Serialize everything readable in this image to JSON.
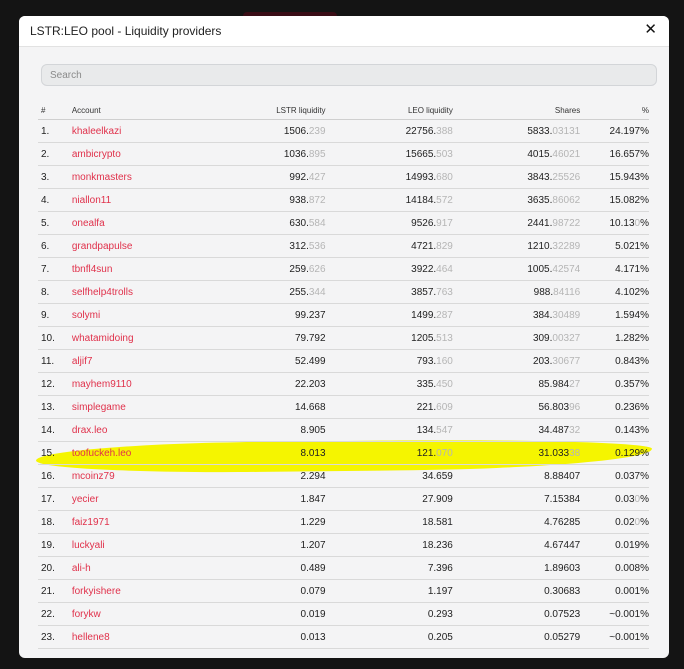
{
  "modal": {
    "title": "LSTR:LEO pool - Liquidity providers",
    "close_label": "✕"
  },
  "search": {
    "placeholder": "Search"
  },
  "table": {
    "headers": {
      "num": "#",
      "account": "Account",
      "lstr": "LSTR liquidity",
      "leo": "LEO liquidity",
      "shares": "Shares",
      "pct": "%"
    },
    "rows": [
      {
        "num": "1.",
        "account": "khaleelkazi",
        "lstr": "1506.",
        "lstr_dim": "239",
        "leo": "22756.",
        "leo_dim": "388",
        "shares": "5833.",
        "shares_dim": "03131",
        "pct": "24.197%",
        "pct_dim": ""
      },
      {
        "num": "2.",
        "account": "ambicrypto",
        "lstr": "1036.",
        "lstr_dim": "895",
        "leo": "15665.",
        "leo_dim": "503",
        "shares": "4015.",
        "shares_dim": "46021",
        "pct": "16.657%",
        "pct_dim": ""
      },
      {
        "num": "3.",
        "account": "monkmasters",
        "lstr": "992.",
        "lstr_dim": "427",
        "leo": "14993.",
        "leo_dim": "680",
        "shares": "3843.",
        "shares_dim": "25526",
        "pct": "15.943%",
        "pct_dim": ""
      },
      {
        "num": "4.",
        "account": "niallon11",
        "lstr": "938.",
        "lstr_dim": "872",
        "leo": "14184.",
        "leo_dim": "572",
        "shares": "3635.",
        "shares_dim": "86062",
        "pct": "15.082%",
        "pct_dim": ""
      },
      {
        "num": "5.",
        "account": "onealfa",
        "lstr": "630.",
        "lstr_dim": "584",
        "leo": "9526.",
        "leo_dim": "917",
        "shares": "2441.",
        "shares_dim": "98722",
        "pct": "10.13",
        "pct_dim": "0",
        "pct_tail": "%"
      },
      {
        "num": "6.",
        "account": "grandpapulse",
        "lstr": "312.",
        "lstr_dim": "536",
        "leo": "4721.",
        "leo_dim": "829",
        "shares": "1210.",
        "shares_dim": "32289",
        "pct": "5.021%",
        "pct_dim": ""
      },
      {
        "num": "7.",
        "account": "tbnfl4sun",
        "lstr": "259.",
        "lstr_dim": "626",
        "leo": "3922.",
        "leo_dim": "464",
        "shares": "1005.",
        "shares_dim": "42574",
        "pct": "4.171%",
        "pct_dim": ""
      },
      {
        "num": "8.",
        "account": "selfhelp4trolls",
        "lstr": "255.",
        "lstr_dim": "344",
        "leo": "3857.",
        "leo_dim": "763",
        "shares": "988.",
        "shares_dim": "84116",
        "pct": "4.102%",
        "pct_dim": ""
      },
      {
        "num": "9.",
        "account": "solymi",
        "lstr": "99.237",
        "lstr_dim": "",
        "leo": "1499.",
        "leo_dim": "287",
        "shares": "384.",
        "shares_dim": "30489",
        "pct": "1.594%",
        "pct_dim": ""
      },
      {
        "num": "10.",
        "account": "whatamidoing",
        "lstr": "79.792",
        "lstr_dim": "",
        "leo": "1205.",
        "leo_dim": "513",
        "shares": "309.",
        "shares_dim": "00327",
        "pct": "1.282%",
        "pct_dim": ""
      },
      {
        "num": "11.",
        "account": "aljif7",
        "lstr": "52.499",
        "lstr_dim": "",
        "leo": "793.",
        "leo_dim": "160",
        "shares": "203.",
        "shares_dim": "30677",
        "pct": "0.843%",
        "pct_dim": ""
      },
      {
        "num": "12.",
        "account": "mayhem9110",
        "lstr": "22.203",
        "lstr_dim": "",
        "leo": "335.",
        "leo_dim": "450",
        "shares": "85.984",
        "shares_dim": "27",
        "pct": "0.357%",
        "pct_dim": ""
      },
      {
        "num": "13.",
        "account": "simplegame",
        "lstr": "14.668",
        "lstr_dim": "",
        "leo": "221.",
        "leo_dim": "609",
        "shares": "56.803",
        "shares_dim": "96",
        "pct": "0.236%",
        "pct_dim": ""
      },
      {
        "num": "14.",
        "account": "drax.leo",
        "lstr": "8.905",
        "lstr_dim": "",
        "leo": "134.",
        "leo_dim": "547",
        "shares": "34.487",
        "shares_dim": "32",
        "pct": "0.143%",
        "pct_dim": ""
      },
      {
        "num": "15.",
        "account": "toofuckeh.leo",
        "lstr": "8.013",
        "lstr_dim": "",
        "leo": "121.",
        "leo_dim": "070",
        "shares": "31.033",
        "shares_dim": "38",
        "pct": "0.129%",
        "pct_dim": ""
      },
      {
        "num": "16.",
        "account": "mcoinz79",
        "lstr": "2.294",
        "lstr_dim": "",
        "leo": "34.659",
        "leo_dim": "",
        "shares": "8.88407",
        "shares_dim": "",
        "pct": "0.037%",
        "pct_dim": ""
      },
      {
        "num": "17.",
        "account": "yecier",
        "lstr": "1.847",
        "lstr_dim": "",
        "leo": "27.909",
        "leo_dim": "",
        "shares": "7.15384",
        "shares_dim": "",
        "pct": "0.03",
        "pct_dim": "0",
        "pct_tail": "%"
      },
      {
        "num": "18.",
        "account": "faiz1971",
        "lstr": "1.229",
        "lstr_dim": "",
        "leo": "18.581",
        "leo_dim": "",
        "shares": "4.76285",
        "shares_dim": "",
        "pct": "0.02",
        "pct_dim": "0",
        "pct_tail": "%"
      },
      {
        "num": "19.",
        "account": "luckyali",
        "lstr": "1.207",
        "lstr_dim": "",
        "leo": "18.236",
        "leo_dim": "",
        "shares": "4.67447",
        "shares_dim": "",
        "pct": "0.019%",
        "pct_dim": ""
      },
      {
        "num": "20.",
        "account": "ali-h",
        "lstr": "0.489",
        "lstr_dim": "",
        "leo": "7.396",
        "leo_dim": "",
        "shares": "1.89603",
        "shares_dim": "",
        "pct": "0.008%",
        "pct_dim": ""
      },
      {
        "num": "21.",
        "account": "forkyishere",
        "lstr": "0.079",
        "lstr_dim": "",
        "leo": "1.197",
        "leo_dim": "",
        "shares": "0.30683",
        "shares_dim": "",
        "pct": "0.001%",
        "pct_dim": ""
      },
      {
        "num": "22.",
        "account": "forykw",
        "lstr": "0.019",
        "lstr_dim": "",
        "leo": "0.293",
        "leo_dim": "",
        "shares": "0.07523",
        "shares_dim": "",
        "pct": "~0.001%",
        "pct_dim": ""
      },
      {
        "num": "23.",
        "account": "hellene8",
        "lstr": "0.013",
        "lstr_dim": "",
        "leo": "0.205",
        "leo_dim": "",
        "shares": "0.05279",
        "shares_dim": "",
        "pct": "~0.001%",
        "pct_dim": ""
      }
    ]
  },
  "colors": {
    "account_link": "#e0314b",
    "highlight": "#f5f500",
    "dim_digits": "#b5b5b5"
  }
}
